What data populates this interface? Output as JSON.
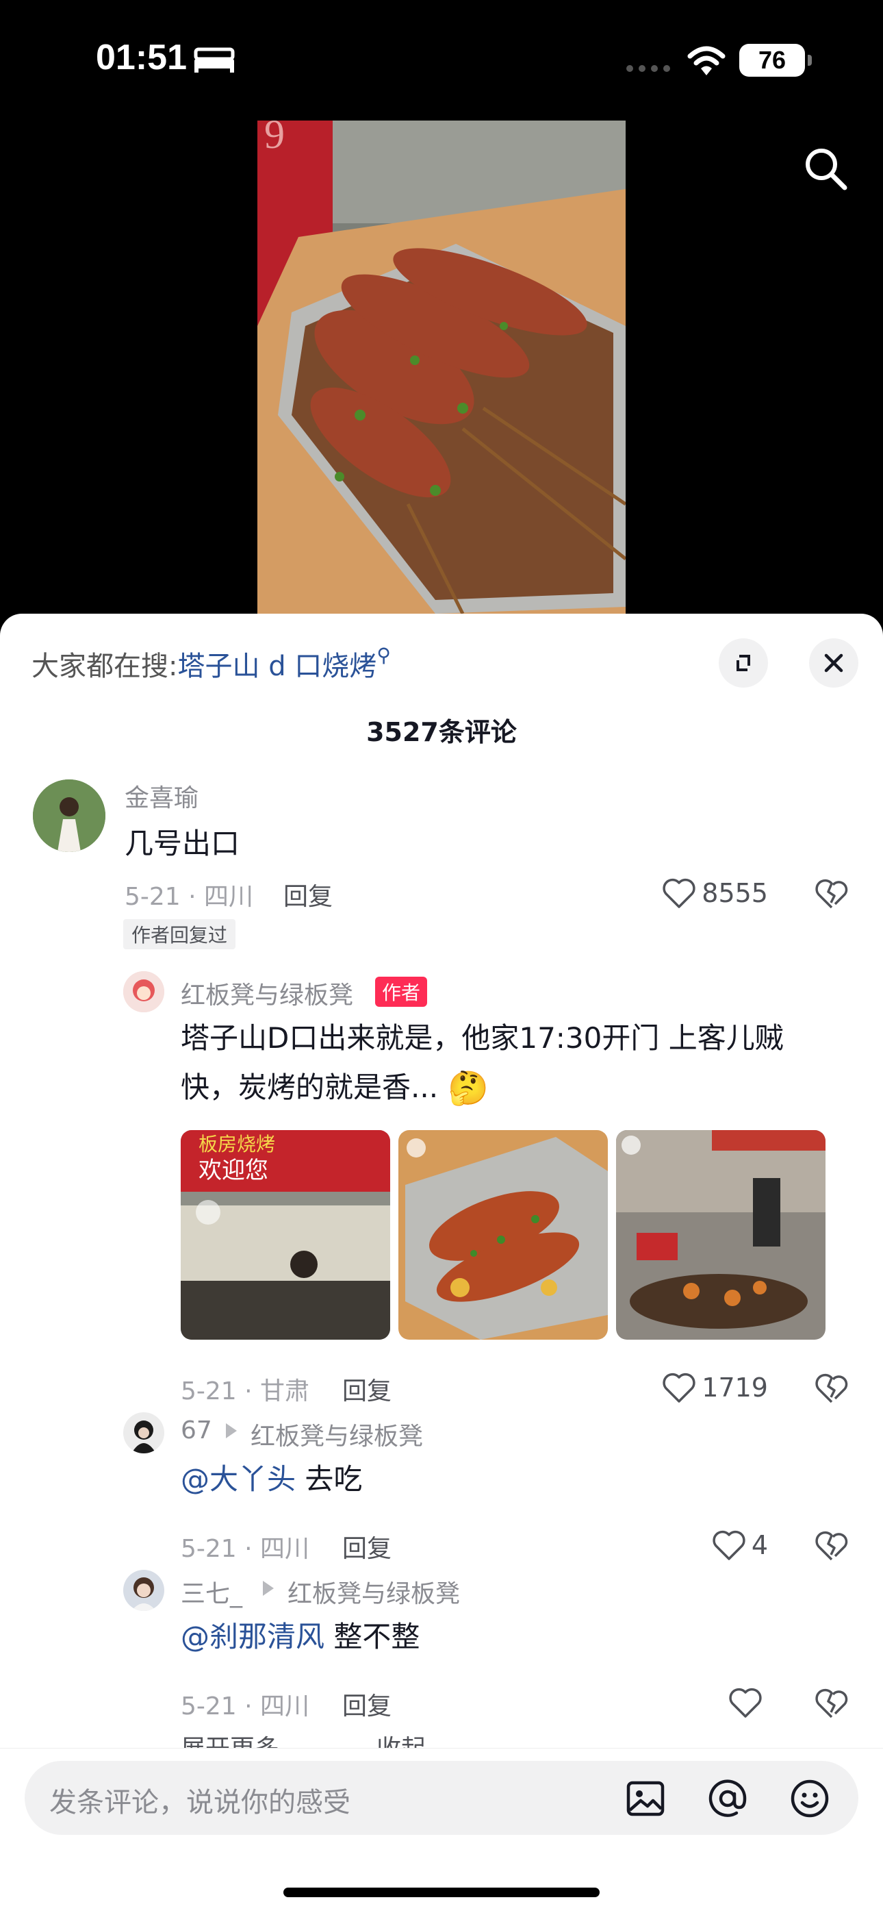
{
  "status": {
    "time": "01:51",
    "battery": "76",
    "icons": [
      "bed-icon",
      "signal-dots-icon",
      "wifi-icon",
      "battery-icon"
    ]
  },
  "video": {
    "icons": [
      "search-icon"
    ]
  },
  "sheet": {
    "hot_prefix": "大家都在搜:",
    "hot_keyword": "塔子山 d 口烧烤",
    "comment_count": "3527条评论",
    "comments": [
      {
        "user": "金喜瑜",
        "text": "几号出口",
        "date_loc": "5-21 · 四川",
        "reply": "回复",
        "likes": "8555",
        "tag": "作者回复过"
      }
    ],
    "replies": [
      {
        "user": "红板凳与绿板凳",
        "badge": "作者",
        "text_line1": "塔子山D口出来就是，他家17:30开门  上客儿贼",
        "text_line2": "快，炭烤的就是香...",
        "date_loc": "5-21 · 甘肃",
        "reply": "回复",
        "likes": "1719"
      },
      {
        "user": "67",
        "to": "红板凳与绿板凳",
        "mention": "@大丫头",
        "text": " 去吃",
        "date_loc": "5-21 · 四川",
        "reply": "回复",
        "likes": "4"
      },
      {
        "user": "三七_",
        "to": "红板凳与绿板凳",
        "mention": "@刹那清风",
        "text": " 整不整",
        "date_loc": "5-21 · 四川",
        "reply": "回复",
        "likes": ""
      }
    ],
    "expand_more": "展开更多",
    "collapse": "收起"
  },
  "input": {
    "placeholder": "发条评论，说说你的感受",
    "icons": [
      "image-icon",
      "at-icon",
      "emoji-icon"
    ]
  }
}
